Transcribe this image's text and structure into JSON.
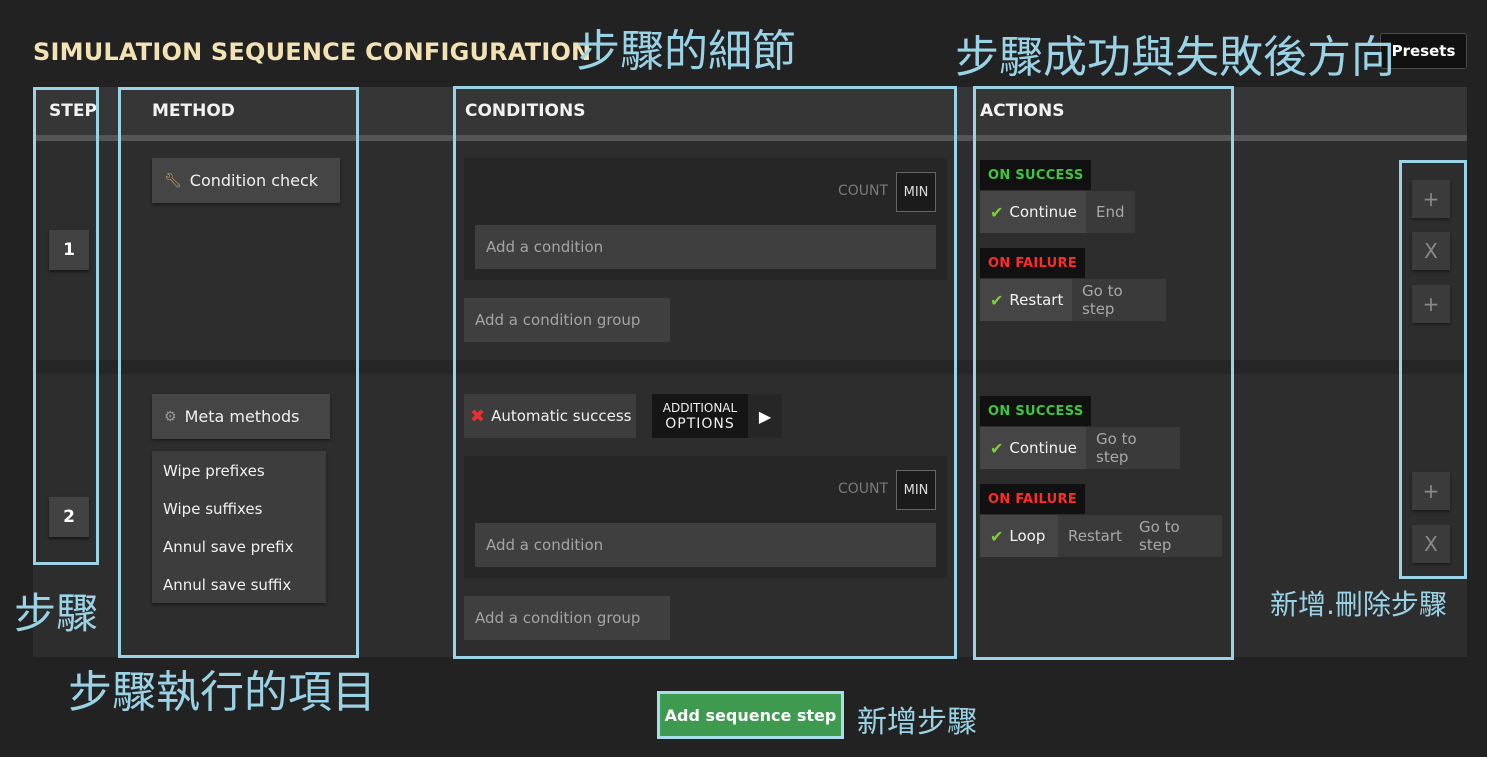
{
  "header": {
    "title": "SIMULATION SEQUENCE CONFIGURATION",
    "presets_label": "Presets"
  },
  "columns": {
    "step": "STEP",
    "method": "METHOD",
    "conditions": "CONDITIONS",
    "actions": "ACTIONS"
  },
  "steps": [
    {
      "number": "1",
      "method_label": "Condition check",
      "conditions": {
        "count_label": "COUNT",
        "min_label": "MIN",
        "add_condition": "Add a condition",
        "add_group": "Add a condition group"
      },
      "actions": {
        "success_tag": "ON SUCCESS",
        "success_selected": "Continue",
        "success_options": [
          "End"
        ],
        "failure_tag": "ON FAILURE",
        "failure_selected": "Restart",
        "failure_options": [
          "Go to step"
        ]
      },
      "side_buttons": [
        "+",
        "X",
        "+"
      ]
    },
    {
      "number": "2",
      "method_label": "Meta methods",
      "method_options": [
        "Wipe prefixes",
        "Wipe suffixes",
        "Annul save prefix",
        "Annul save suffix"
      ],
      "condition_chip": "Automatic success",
      "additional_options": {
        "line1": "ADDITIONAL",
        "line2": "OPTIONS"
      },
      "conditions": {
        "count_label": "COUNT",
        "min_label": "MIN",
        "add_condition": "Add a condition",
        "add_group": "Add a condition group"
      },
      "actions": {
        "success_tag": "ON SUCCESS",
        "success_selected": "Continue",
        "success_options": [
          "Go to step"
        ],
        "failure_tag": "ON FAILURE",
        "failure_selected": "Loop",
        "failure_options": [
          "Restart",
          "Go to step"
        ]
      },
      "side_buttons": [
        "+",
        "X"
      ]
    }
  ],
  "add_step_label": "Add sequence step",
  "annotations": {
    "details": "步驟的細節",
    "direction": "步驟成功與失敗後方向",
    "step": "步驟",
    "method_items": "步驟執行的項目",
    "add_delete": "新增.刪除步驟",
    "add_step": "新增步驟"
  },
  "colors": {
    "title": "#f3e3b4",
    "success": "#3ec63e",
    "failure": "#ff2a2a",
    "highlight": "#9ad2e6",
    "add_step": "#3e9a4e"
  },
  "icons": {
    "condition_check": "wrench-icon",
    "meta_methods": "gear-orb-icon",
    "automatic_success": "red-x-icon",
    "check": "check-icon",
    "additional": "chevron-right-icon"
  }
}
